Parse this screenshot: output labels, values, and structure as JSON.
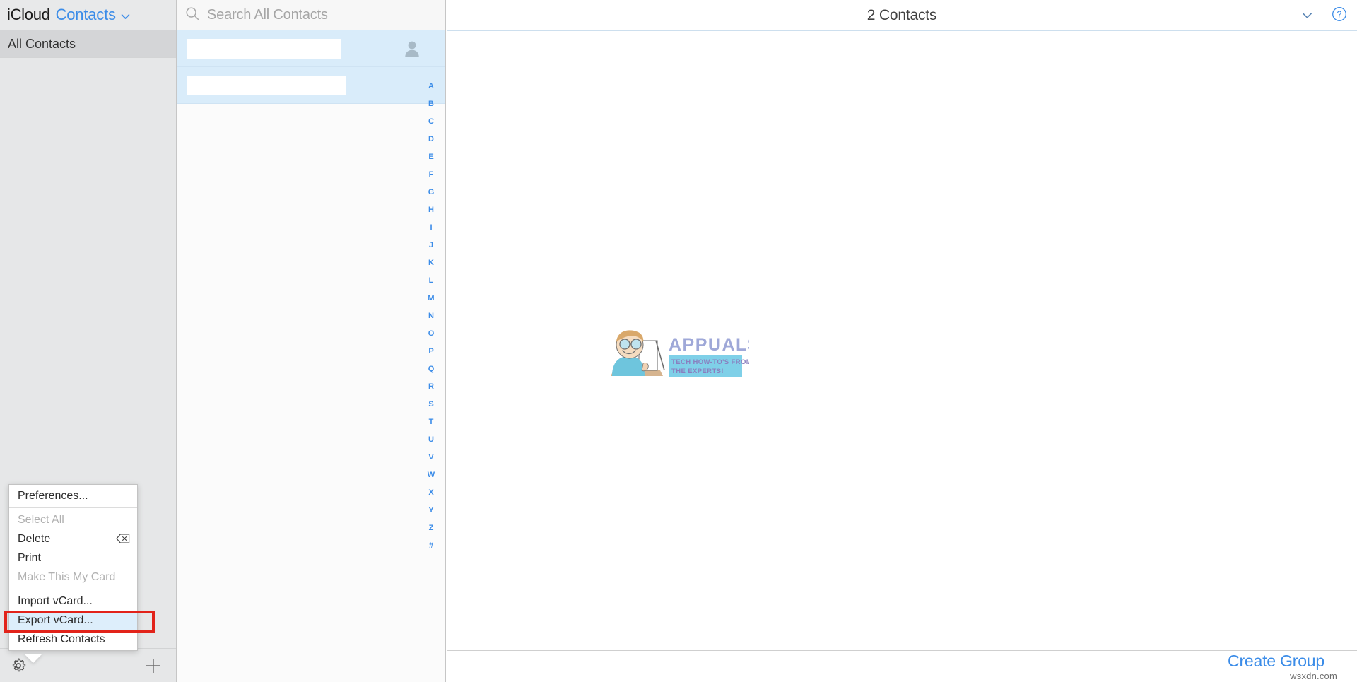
{
  "app": {
    "brand": "iCloud",
    "section": "Contacts",
    "section_caret": "chevron-down"
  },
  "sidebar": {
    "groups": [
      {
        "label": "All Contacts",
        "selected": true
      }
    ],
    "toolbar": {
      "settings_icon": "gear-icon",
      "add_icon": "plus-icon"
    }
  },
  "popup_menu": {
    "visible": true,
    "items": [
      {
        "label": "Preferences...",
        "disabled": false,
        "highlight": false,
        "shortcut": "",
        "separator_after": true
      },
      {
        "label": "Select All",
        "disabled": true,
        "highlight": false,
        "shortcut": "",
        "separator_after": false
      },
      {
        "label": "Delete",
        "disabled": false,
        "highlight": false,
        "shortcut": "delete-key-icon",
        "separator_after": false
      },
      {
        "label": "Print",
        "disabled": false,
        "highlight": false,
        "shortcut": "",
        "separator_after": false
      },
      {
        "label": "Make This My Card",
        "disabled": true,
        "highlight": false,
        "shortcut": "",
        "separator_after": true
      },
      {
        "label": "Import vCard...",
        "disabled": false,
        "highlight": false,
        "shortcut": "",
        "separator_after": false
      },
      {
        "label": "Export vCard...",
        "disabled": false,
        "highlight": true,
        "shortcut": "",
        "separator_after": false
      },
      {
        "label": "Refresh Contacts",
        "disabled": false,
        "highlight": false,
        "shortcut": "",
        "separator_after": false
      }
    ],
    "annotation_color": "#e2231a",
    "highlight_color": "#ddeefb"
  },
  "search": {
    "value": "",
    "placeholder": "Search All Contacts",
    "icon": "search-icon"
  },
  "contact_list": {
    "rows": [
      {
        "name": "",
        "redacted": true,
        "redacted_width": 178,
        "avatar_icon": "person-icon",
        "has_avatar": true,
        "selected": true
      },
      {
        "name": "",
        "redacted": true,
        "redacted_width": 183,
        "avatar_icon": "",
        "has_avatar": false,
        "selected": true
      }
    ],
    "alphabet": [
      "A",
      "B",
      "C",
      "D",
      "E",
      "F",
      "G",
      "H",
      "I",
      "J",
      "K",
      "L",
      "M",
      "N",
      "O",
      "P",
      "Q",
      "R",
      "S",
      "T",
      "U",
      "V",
      "W",
      "X",
      "Y",
      "Z",
      "#"
    ],
    "accent_color": "#3b8ce8",
    "selected_row_color": "#d9ecfa"
  },
  "detail": {
    "title": "2 Contacts",
    "caret_icon": "chevron-down-icon",
    "help_icon": "question-mark-icon",
    "watermark": {
      "brand": "APPUALS",
      "tagline_line1": "TECH HOW-TO'S FROM",
      "tagline_line2": "THE EXPERTS!"
    },
    "footer": {
      "create_group_label": "Create Group",
      "site_watermark": "wsxdn.com"
    }
  }
}
